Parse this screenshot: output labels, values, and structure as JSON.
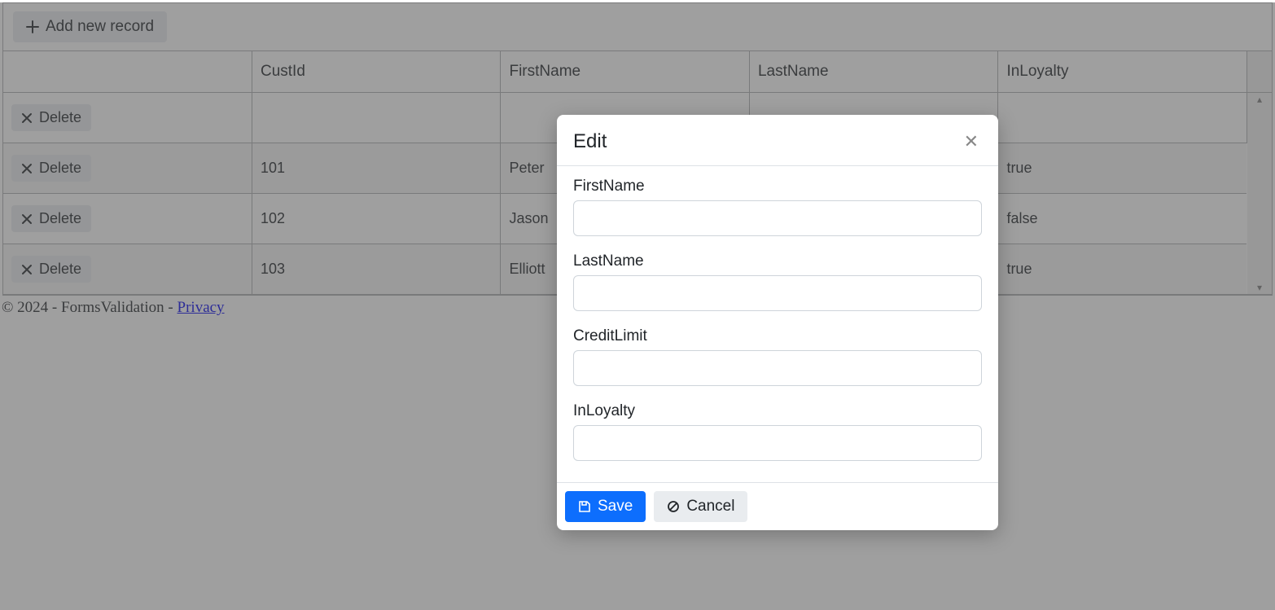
{
  "toolbar": {
    "add_label": "Add new record"
  },
  "columns": {
    "cmd": "",
    "id": "CustId",
    "first": "FirstName",
    "last": "LastName",
    "loyalty": "InLoyalty"
  },
  "delete_label": "Delete",
  "rows": [
    {
      "id": "",
      "first": "",
      "last": "",
      "loyalty": ""
    },
    {
      "id": "101",
      "first": "Peter",
      "last": "",
      "loyalty": "true"
    },
    {
      "id": "102",
      "first": "Jason",
      "last": "",
      "loyalty": "false"
    },
    {
      "id": "103",
      "first": "Elliott",
      "last": "",
      "loyalty": "true"
    }
  ],
  "footer": {
    "copyright": "© 2024 - FormsValidation - ",
    "privacy": "Privacy"
  },
  "dialog": {
    "title": "Edit",
    "fields": {
      "first": {
        "label": "FirstName",
        "value": ""
      },
      "last": {
        "label": "LastName",
        "value": ""
      },
      "credit": {
        "label": "CreditLimit",
        "value": ""
      },
      "loyalty": {
        "label": "InLoyalty",
        "value": ""
      }
    },
    "save": "Save",
    "cancel": "Cancel"
  }
}
